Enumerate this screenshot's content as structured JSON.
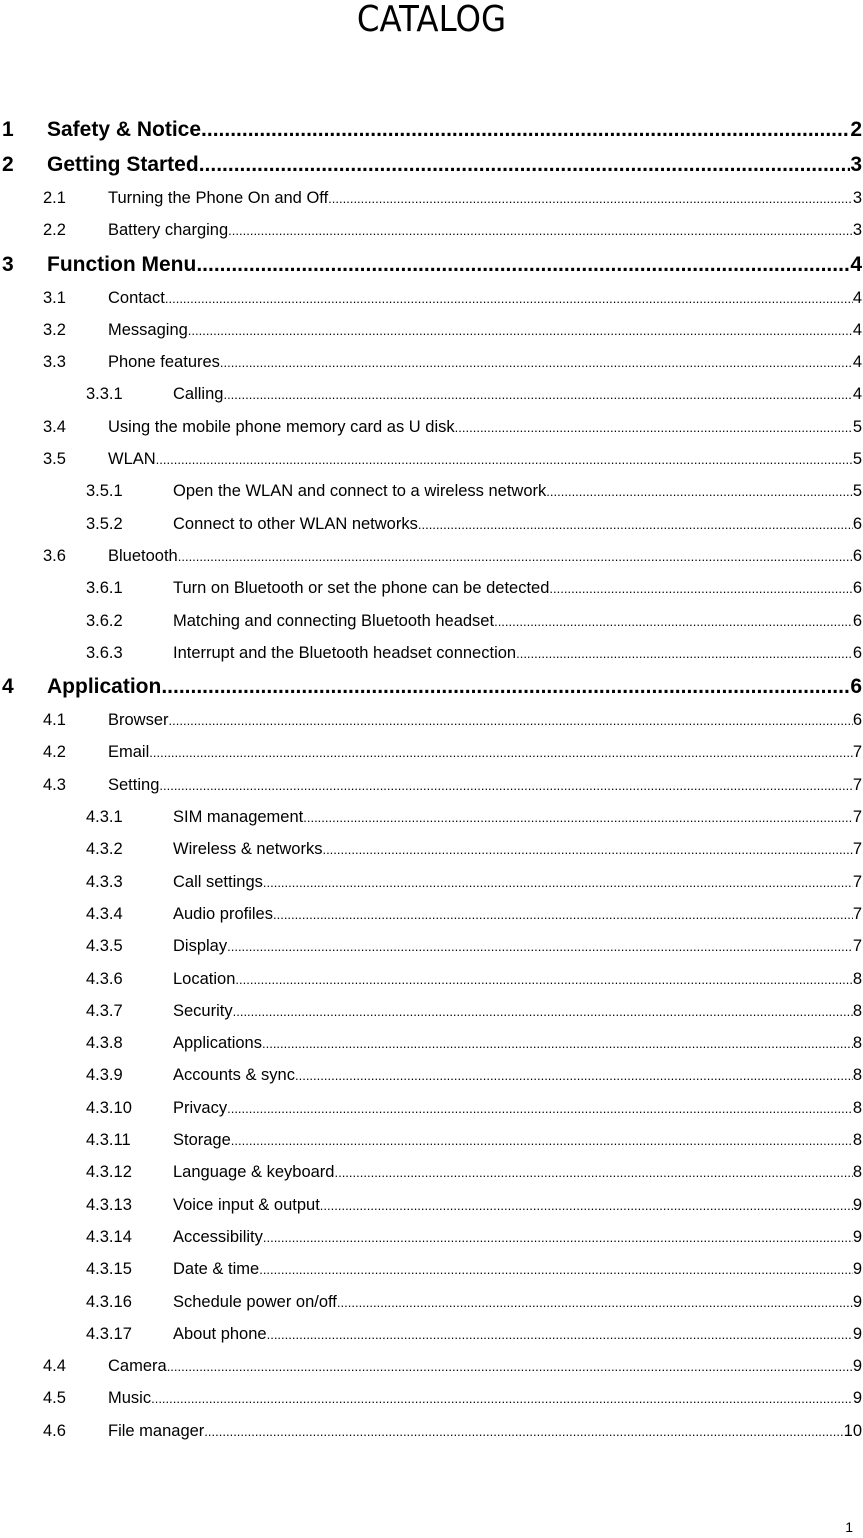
{
  "title": "CATALOG",
  "page_number": "1",
  "toc": [
    {
      "level": 1,
      "num": "1",
      "label": "Safety & Notice",
      "page": "2"
    },
    {
      "level": 1,
      "num": "2",
      "label": "Getting Started",
      "page": "3"
    },
    {
      "level": 2,
      "num": "2.1",
      "label": "Turning the Phone On and Off",
      "page": "3"
    },
    {
      "level": 2,
      "num": "2.2",
      "label": "Battery charging",
      "page": "3"
    },
    {
      "level": 1,
      "num": "3",
      "label": "Function Menu",
      "page": "4"
    },
    {
      "level": 2,
      "num": "3.1",
      "label": "Contact",
      "page": "4"
    },
    {
      "level": 2,
      "num": "3.2",
      "label": "Messaging",
      "page": "4"
    },
    {
      "level": 2,
      "num": "3.3",
      "label": "Phone features",
      "page": "4"
    },
    {
      "level": 3,
      "num": "3.3.1",
      "label": "Calling",
      "page": "4"
    },
    {
      "level": 2,
      "num": "3.4",
      "label": "Using the mobile phone memory card as U disk",
      "page": "5"
    },
    {
      "level": 2,
      "num": "3.5",
      "label": "WLAN",
      "page": "5"
    },
    {
      "level": 3,
      "num": "3.5.1",
      "label": "Open the WLAN and connect to a wireless network",
      "page": "5"
    },
    {
      "level": 3,
      "num": "3.5.2",
      "label": "Connect to other WLAN networks",
      "page": "6"
    },
    {
      "level": 2,
      "num": "3.6",
      "label": "Bluetooth",
      "page": "6"
    },
    {
      "level": 3,
      "num": "3.6.1",
      "label": "Turn on Bluetooth or set the phone can be detected",
      "page": "6"
    },
    {
      "level": 3,
      "num": "3.6.2",
      "label": "Matching and connecting Bluetooth headset",
      "page": "6"
    },
    {
      "level": 3,
      "num": "3.6.3",
      "label": "Interrupt and the Bluetooth headset connection",
      "page": "6"
    },
    {
      "level": 1,
      "num": "4",
      "label": "Application",
      "page": "6"
    },
    {
      "level": 2,
      "num": "4.1",
      "label": "Browser",
      "page": "6"
    },
    {
      "level": 2,
      "num": "4.2",
      "label": "Email",
      "page": "7"
    },
    {
      "level": 2,
      "num": "4.3",
      "label": "Setting",
      "page": "7"
    },
    {
      "level": 3,
      "num": "4.3.1",
      "label": "SIM management",
      "page": "7"
    },
    {
      "level": 3,
      "num": "4.3.2",
      "label": "Wireless & networks",
      "page": "7"
    },
    {
      "level": 3,
      "num": "4.3.3",
      "label": "Call settings",
      "page": "7"
    },
    {
      "level": 3,
      "num": "4.3.4",
      "label": "Audio profiles",
      "page": "7"
    },
    {
      "level": 3,
      "num": "4.3.5",
      "label": "Display",
      "page": "7"
    },
    {
      "level": 3,
      "num": "4.3.6",
      "label": "Location",
      "page": "8"
    },
    {
      "level": 3,
      "num": "4.3.7",
      "label": "Security",
      "page": "8"
    },
    {
      "level": 3,
      "num": "4.3.8",
      "label": "Applications",
      "page": "8"
    },
    {
      "level": 3,
      "num": "4.3.9",
      "label": "Accounts & sync",
      "page": "8"
    },
    {
      "level": 3,
      "num": "4.3.10",
      "label": "Privacy",
      "page": "8"
    },
    {
      "level": 3,
      "num": "4.3.11",
      "label": "Storage",
      "page": "8"
    },
    {
      "level": 3,
      "num": "4.3.12",
      "label": "Language & keyboard",
      "page": "8"
    },
    {
      "level": 3,
      "num": "4.3.13",
      "label": "Voice input & output",
      "page": "9"
    },
    {
      "level": 3,
      "num": "4.3.14",
      "label": "Accessibility",
      "page": "9"
    },
    {
      "level": 3,
      "num": "4.3.15",
      "label": "Date & time",
      "page": "9"
    },
    {
      "level": 3,
      "num": "4.3.16",
      "label": "Schedule power on/off",
      "page": "9"
    },
    {
      "level": 3,
      "num": "4.3.17",
      "label": "About phone",
      "page": "9"
    },
    {
      "level": 2,
      "num": "4.4",
      "label": "Camera",
      "page": "9"
    },
    {
      "level": 2,
      "num": "4.5",
      "label": "Music",
      "page": "9"
    },
    {
      "level": 2,
      "num": "4.6",
      "label": "File manager",
      "page": "10"
    }
  ]
}
